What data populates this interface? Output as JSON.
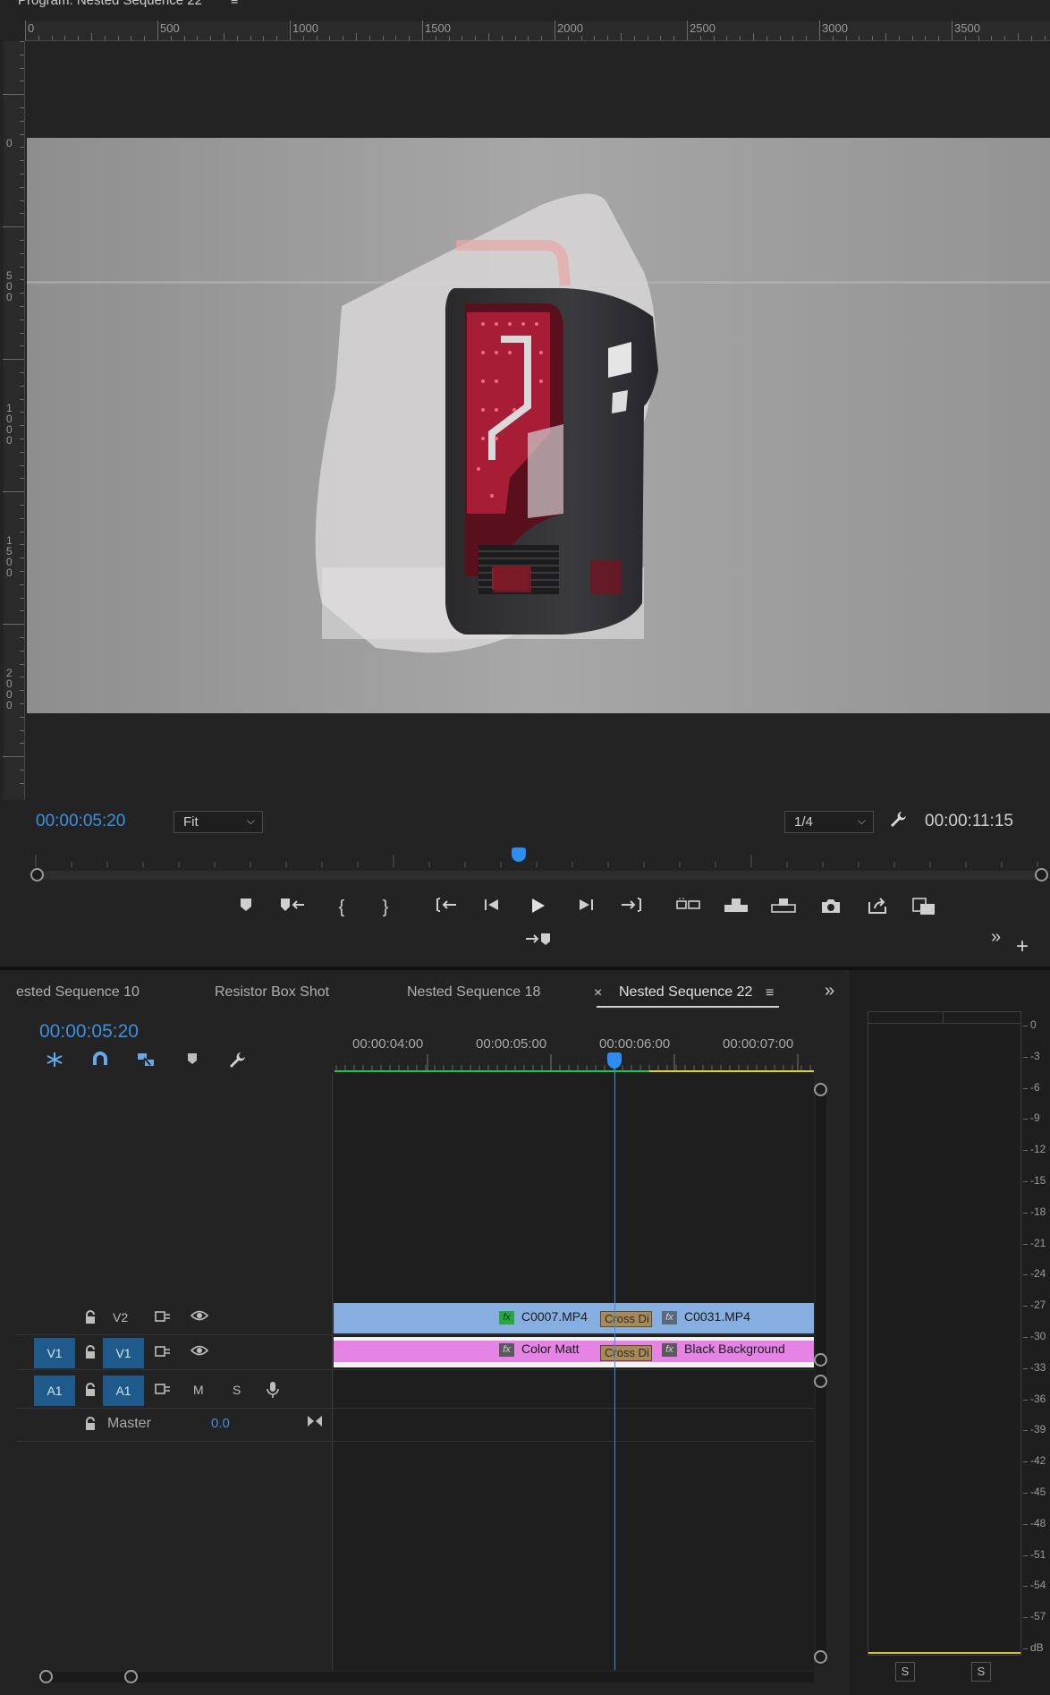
{
  "program_monitor": {
    "title": "Program: Nested Sequence 22",
    "menu_icon": "≡",
    "h_ruler_labels": [
      "0",
      "500",
      "1000",
      "1500",
      "2000",
      "2500",
      "3000",
      "3500"
    ],
    "v_ruler_labels": [
      "0",
      "500",
      "1000",
      "1500",
      "2000"
    ],
    "current_timecode": "00:00:05:20",
    "zoom_value": "Fit",
    "resolution_value": "1/4",
    "duration_timecode": "00:00:11:15",
    "playhead_position": 0.48
  },
  "transport": {
    "marker": "add-marker-icon",
    "goto_prev_marker": "go-to-previous-marker-icon",
    "mark_in": "{",
    "mark_out": "}",
    "goto_in": "go-to-in-icon",
    "step_back": "step-back-icon",
    "play": "play-icon",
    "step_forward": "step-forward-icon",
    "goto_out": "go-to-out-icon",
    "insert_overwrite": "insert-overwrite-icon"
  },
  "timeline": {
    "tabs": [
      "ested Sequence 10",
      "Resistor Box Shot",
      "Nested Sequence 18",
      "Nested Sequence 22"
    ],
    "tab_close": "×",
    "tab_menu": "≡",
    "overflow": "»",
    "timecode": "00:00:05:20",
    "time_labels": [
      "00:00:04:00",
      "00:00:05:00",
      "00:00:06:00",
      "00:00:07:00"
    ],
    "tracks": {
      "v2": {
        "label": "V2"
      },
      "v1": {
        "source": "V1",
        "label": "V1"
      },
      "a1": {
        "source": "A1",
        "label": "A1",
        "mute": "M",
        "solo": "S"
      }
    },
    "clips": {
      "v2_a": "C0007.MP4",
      "v2_b": "C0031.MP4",
      "v1_a": "Color Matt",
      "v1_b": "Black Background",
      "xfade_v2": "Cross Di",
      "xfade_v1": "Cross Di"
    },
    "fx_badge": "fx",
    "master_label": "Master",
    "master_value": "0.0",
    "colors": {
      "video_clip": "#86aee0",
      "graphic_clip": "#e584e5",
      "playhead": "#2d8cf0",
      "target_button": "#1f5a8c"
    }
  },
  "audio_meter": {
    "db_labels": [
      "0",
      "-3",
      "-6",
      "-9",
      "-12",
      "-15",
      "-18",
      "-21",
      "-24",
      "-27",
      "-30",
      "-33",
      "-36",
      "-39",
      "-42",
      "-45",
      "-48",
      "-51",
      "-54",
      "-57",
      "dB"
    ],
    "solo_left": "S",
    "solo_right": "S"
  }
}
